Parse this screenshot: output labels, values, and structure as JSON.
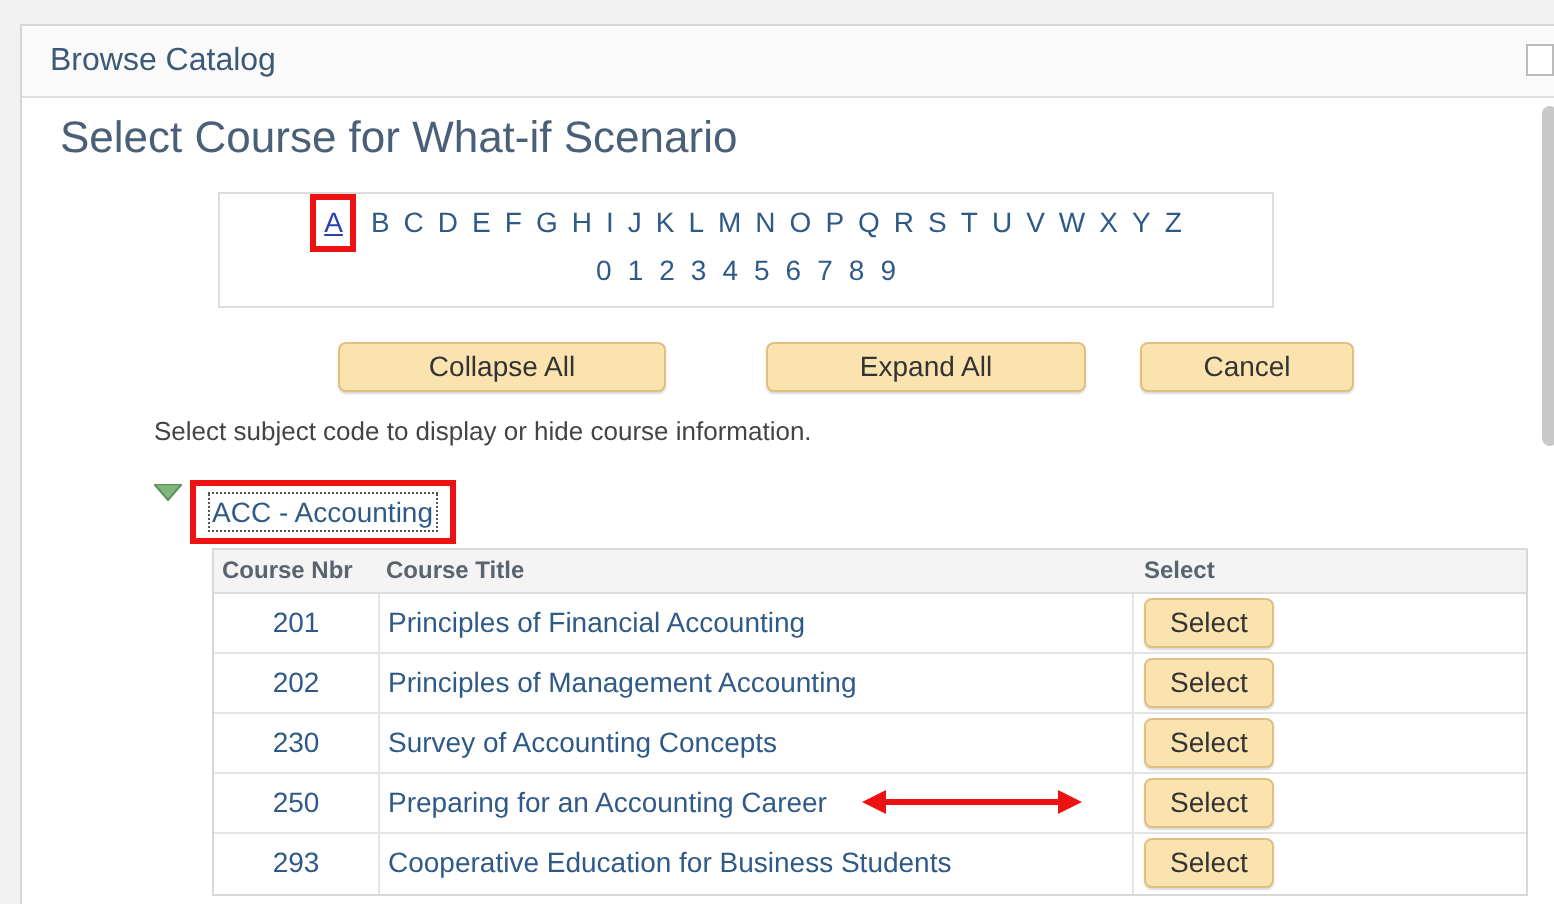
{
  "window": {
    "title": "Browse Catalog"
  },
  "heading": "Select Course for What-if Scenario",
  "letters": [
    {
      "label": "A",
      "selected": true,
      "highlighted": true
    },
    {
      "label": "B",
      "selected": false,
      "highlighted": false
    },
    {
      "label": "C",
      "selected": false,
      "highlighted": false
    },
    {
      "label": "D",
      "selected": false,
      "highlighted": false
    },
    {
      "label": "E",
      "selected": false,
      "highlighted": false
    },
    {
      "label": "F",
      "selected": false,
      "highlighted": false
    },
    {
      "label": "G",
      "selected": false,
      "highlighted": false
    },
    {
      "label": "H",
      "selected": false,
      "highlighted": false
    },
    {
      "label": "I",
      "selected": false,
      "highlighted": false
    },
    {
      "label": "J",
      "selected": false,
      "highlighted": false
    },
    {
      "label": "K",
      "selected": false,
      "highlighted": false
    },
    {
      "label": "L",
      "selected": false,
      "highlighted": false
    },
    {
      "label": "M",
      "selected": false,
      "highlighted": false
    },
    {
      "label": "N",
      "selected": false,
      "highlighted": false
    },
    {
      "label": "O",
      "selected": false,
      "highlighted": false
    },
    {
      "label": "P",
      "selected": false,
      "highlighted": false
    },
    {
      "label": "Q",
      "selected": false,
      "highlighted": false
    },
    {
      "label": "R",
      "selected": false,
      "highlighted": false
    },
    {
      "label": "S",
      "selected": false,
      "highlighted": false
    },
    {
      "label": "T",
      "selected": false,
      "highlighted": false
    },
    {
      "label": "U",
      "selected": false,
      "highlighted": false
    },
    {
      "label": "V",
      "selected": false,
      "highlighted": false
    },
    {
      "label": "W",
      "selected": false,
      "highlighted": false
    },
    {
      "label": "X",
      "selected": false,
      "highlighted": false
    },
    {
      "label": "Y",
      "selected": false,
      "highlighted": false
    },
    {
      "label": "Z",
      "selected": false,
      "highlighted": false
    }
  ],
  "digits": [
    "0",
    "1",
    "2",
    "3",
    "4",
    "5",
    "6",
    "7",
    "8",
    "9"
  ],
  "buttons": [
    "Collapse All",
    "Expand All",
    "Cancel"
  ],
  "instruction": "Select subject code to display or hide course information.",
  "subject": {
    "label": "ACC - Accounting",
    "expanded": true,
    "highlighted": true
  },
  "table": {
    "columns": [
      "Course Nbr",
      "Course Title",
      "Select"
    ],
    "rows": [
      {
        "nbr": "201",
        "title": "Principles of Financial Accounting",
        "button": "Select",
        "arrow": false
      },
      {
        "nbr": "202",
        "title": "Principles of Management Accounting",
        "button": "Select",
        "arrow": false
      },
      {
        "nbr": "230",
        "title": "Survey of Accounting Concepts",
        "button": "Select",
        "arrow": false
      },
      {
        "nbr": "250",
        "title": "Preparing for an Accounting Career",
        "button": "Select",
        "arrow": true
      },
      {
        "nbr": "293",
        "title": "Cooperative Education for Business Students",
        "button": "Select",
        "arrow": false
      }
    ]
  }
}
